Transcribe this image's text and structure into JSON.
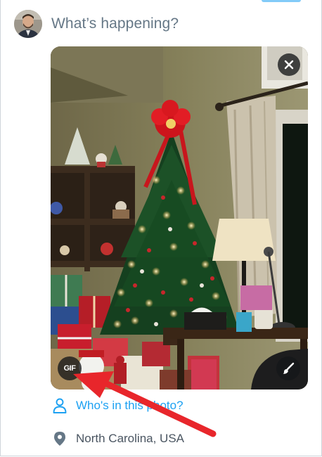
{
  "compose": {
    "placeholder": "What’s happening?"
  },
  "media": {
    "gif_badge": "GIF",
    "close_icon": "close-icon",
    "edit_icon": "paintbrush-icon"
  },
  "tag_people": {
    "label": "Who's in this photo?",
    "icon": "person-outline-icon"
  },
  "location": {
    "label": "North Carolina, USA",
    "icon": "location-pin-icon"
  },
  "colors": {
    "accent": "#1da1f2",
    "placeholder": "#657786",
    "annotation_arrow": "#e8262b"
  }
}
